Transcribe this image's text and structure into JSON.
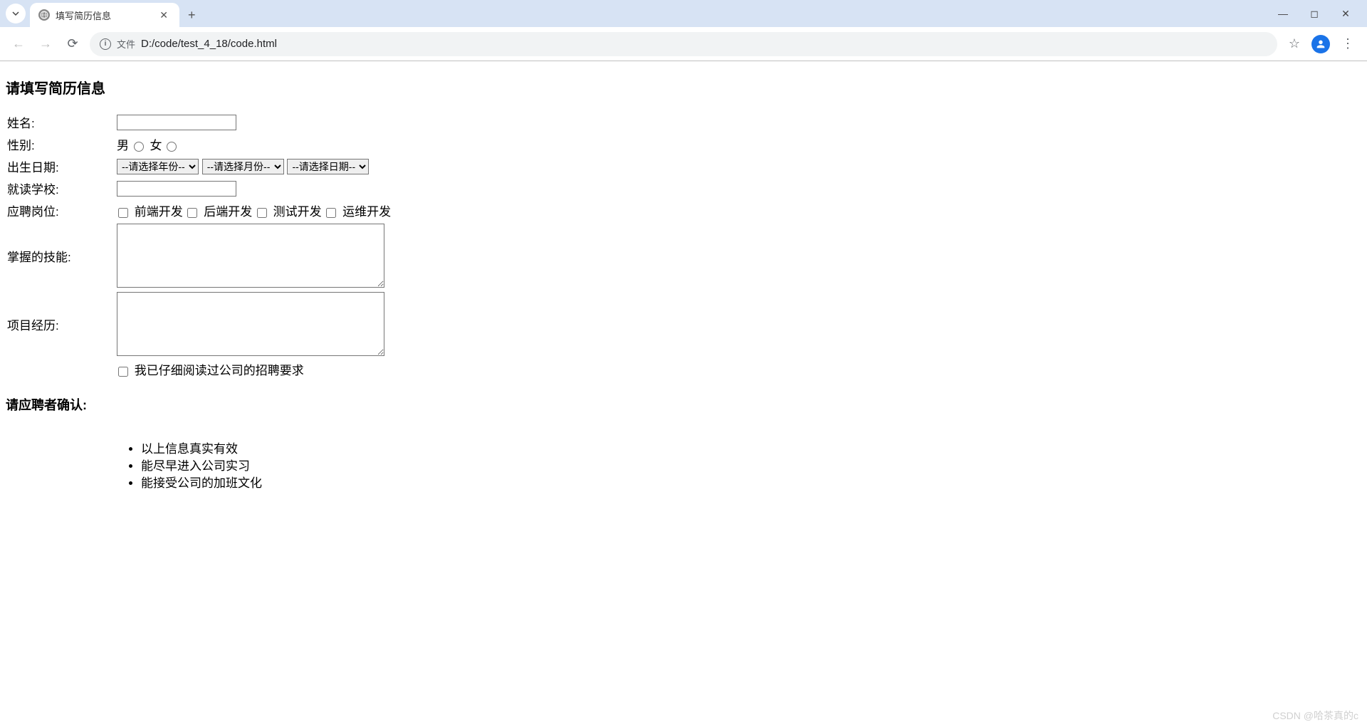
{
  "browser": {
    "tab_title": "填写简历信息",
    "url_scheme_label": "文件",
    "url_path": "D:/code/test_4_18/code.html"
  },
  "page": {
    "heading": "请填写简历信息",
    "labels": {
      "name": "姓名:",
      "gender": "性别:",
      "birth": "出生日期:",
      "school": "就读学校:",
      "position": "应聘岗位:",
      "skills": "掌握的技能:",
      "projects": "项目经历:"
    },
    "gender_options": {
      "male": "男",
      "female": "女"
    },
    "birth_selects": {
      "year": "--请选择年份--",
      "month": "--请选择月份--",
      "day": "--请选择日期--"
    },
    "position_options": {
      "frontend": "前端开发",
      "backend": "后端开发",
      "test": "测试开发",
      "ops": "运维开发"
    },
    "agree_label": "我已仔细阅读过公司的招聘要求",
    "confirm_heading": "请应聘者确认:",
    "confirm_items": [
      "以上信息真实有效",
      "能尽早进入公司实习",
      "能接受公司的加班文化"
    ]
  },
  "watermark": "CSDN @哈茶真的c"
}
